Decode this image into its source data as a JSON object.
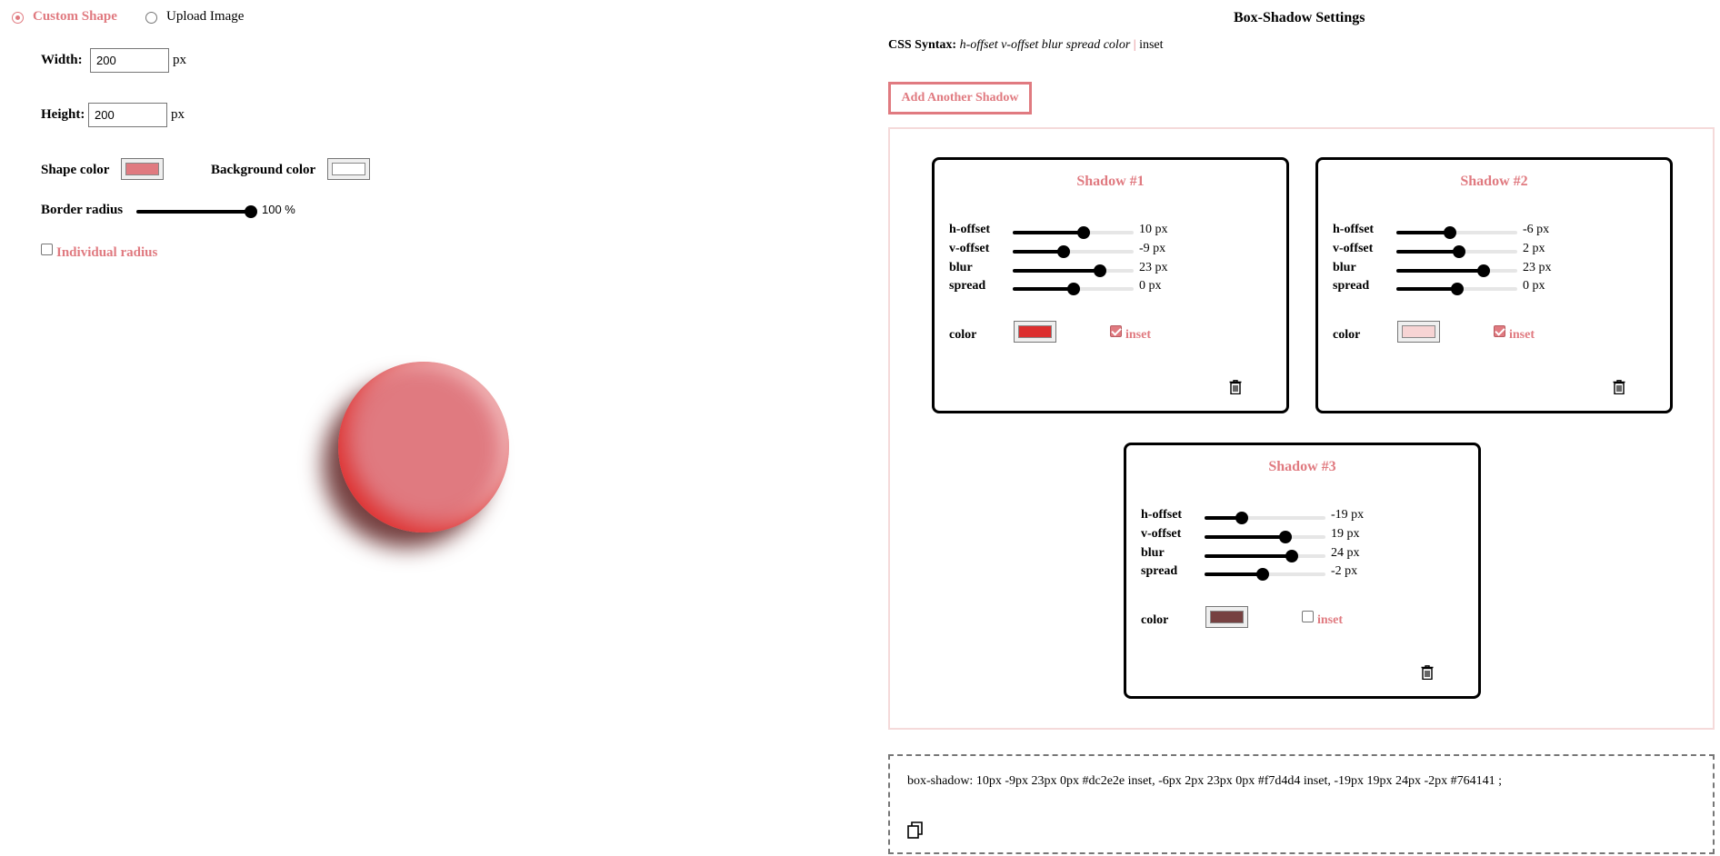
{
  "shape_mode": {
    "custom_label": "Custom Shape",
    "upload_label": "Upload Image"
  },
  "dimensions": {
    "width_label": "Width:",
    "width_value": "200",
    "height_label": "Height:",
    "height_value": "200",
    "unit": "px"
  },
  "colors": {
    "shape_label": "Shape color",
    "shape_value": "#e07a80",
    "background_label": "Background color",
    "background_value": "#ffffff",
    "accent": "#e07a80"
  },
  "border_radius": {
    "label": "Border radius",
    "value": 100,
    "display": "100 %",
    "individual_label": "Individual radius",
    "individual_checked": false
  },
  "settings": {
    "heading": "Box-Shadow Settings",
    "syntax_label": "CSS Syntax:",
    "syntax_params": "h-offset v-offset blur spread color",
    "syntax_sep": "|",
    "syntax_inset": "inset",
    "add_button": "Add Another Shadow"
  },
  "shadows": [
    {
      "title": "Shadow #1",
      "h_label": "h-offset",
      "h_value": "10 px",
      "h_pos": 0.59,
      "v_label": "v-offset",
      "v_value": "-9 px",
      "v_pos": 0.42,
      "blur_label": "blur",
      "blur_value": "23 px",
      "blur_pos": 0.72,
      "spread_label": "spread",
      "spread_value": "0 px",
      "spread_pos": 0.5,
      "color_label": "color",
      "color": "#dc2e2e",
      "inset_label": "inset",
      "inset": true
    },
    {
      "title": "Shadow #2",
      "h_label": "h-offset",
      "h_value": "-6 px",
      "h_pos": 0.44,
      "v_label": "v-offset",
      "v_value": "2 px",
      "v_pos": 0.52,
      "blur_label": "blur",
      "blur_value": "23 px",
      "blur_pos": 0.72,
      "spread_label": "spread",
      "spread_value": "0 px",
      "spread_pos": 0.5,
      "color_label": "color",
      "color": "#f7d4d4",
      "inset_label": "inset",
      "inset": true
    },
    {
      "title": "Shadow #3",
      "h_label": "h-offset",
      "h_value": "-19 px",
      "h_pos": 0.31,
      "v_label": "v-offset",
      "v_value": "19 px",
      "v_pos": 0.67,
      "blur_label": "blur",
      "blur_value": "24 px",
      "blur_pos": 0.72,
      "spread_label": "spread",
      "spread_value": "-2 px",
      "spread_pos": 0.48,
      "color_label": "color",
      "color": "#764141",
      "inset_label": "inset",
      "inset": false
    }
  ],
  "output": {
    "css_text": "box-shadow: 10px -9px 23px 0px #dc2e2e inset, -6px 2px 23px 0px #f7d4d4 inset, -19px 19px 24px -2px #764141 ;"
  }
}
